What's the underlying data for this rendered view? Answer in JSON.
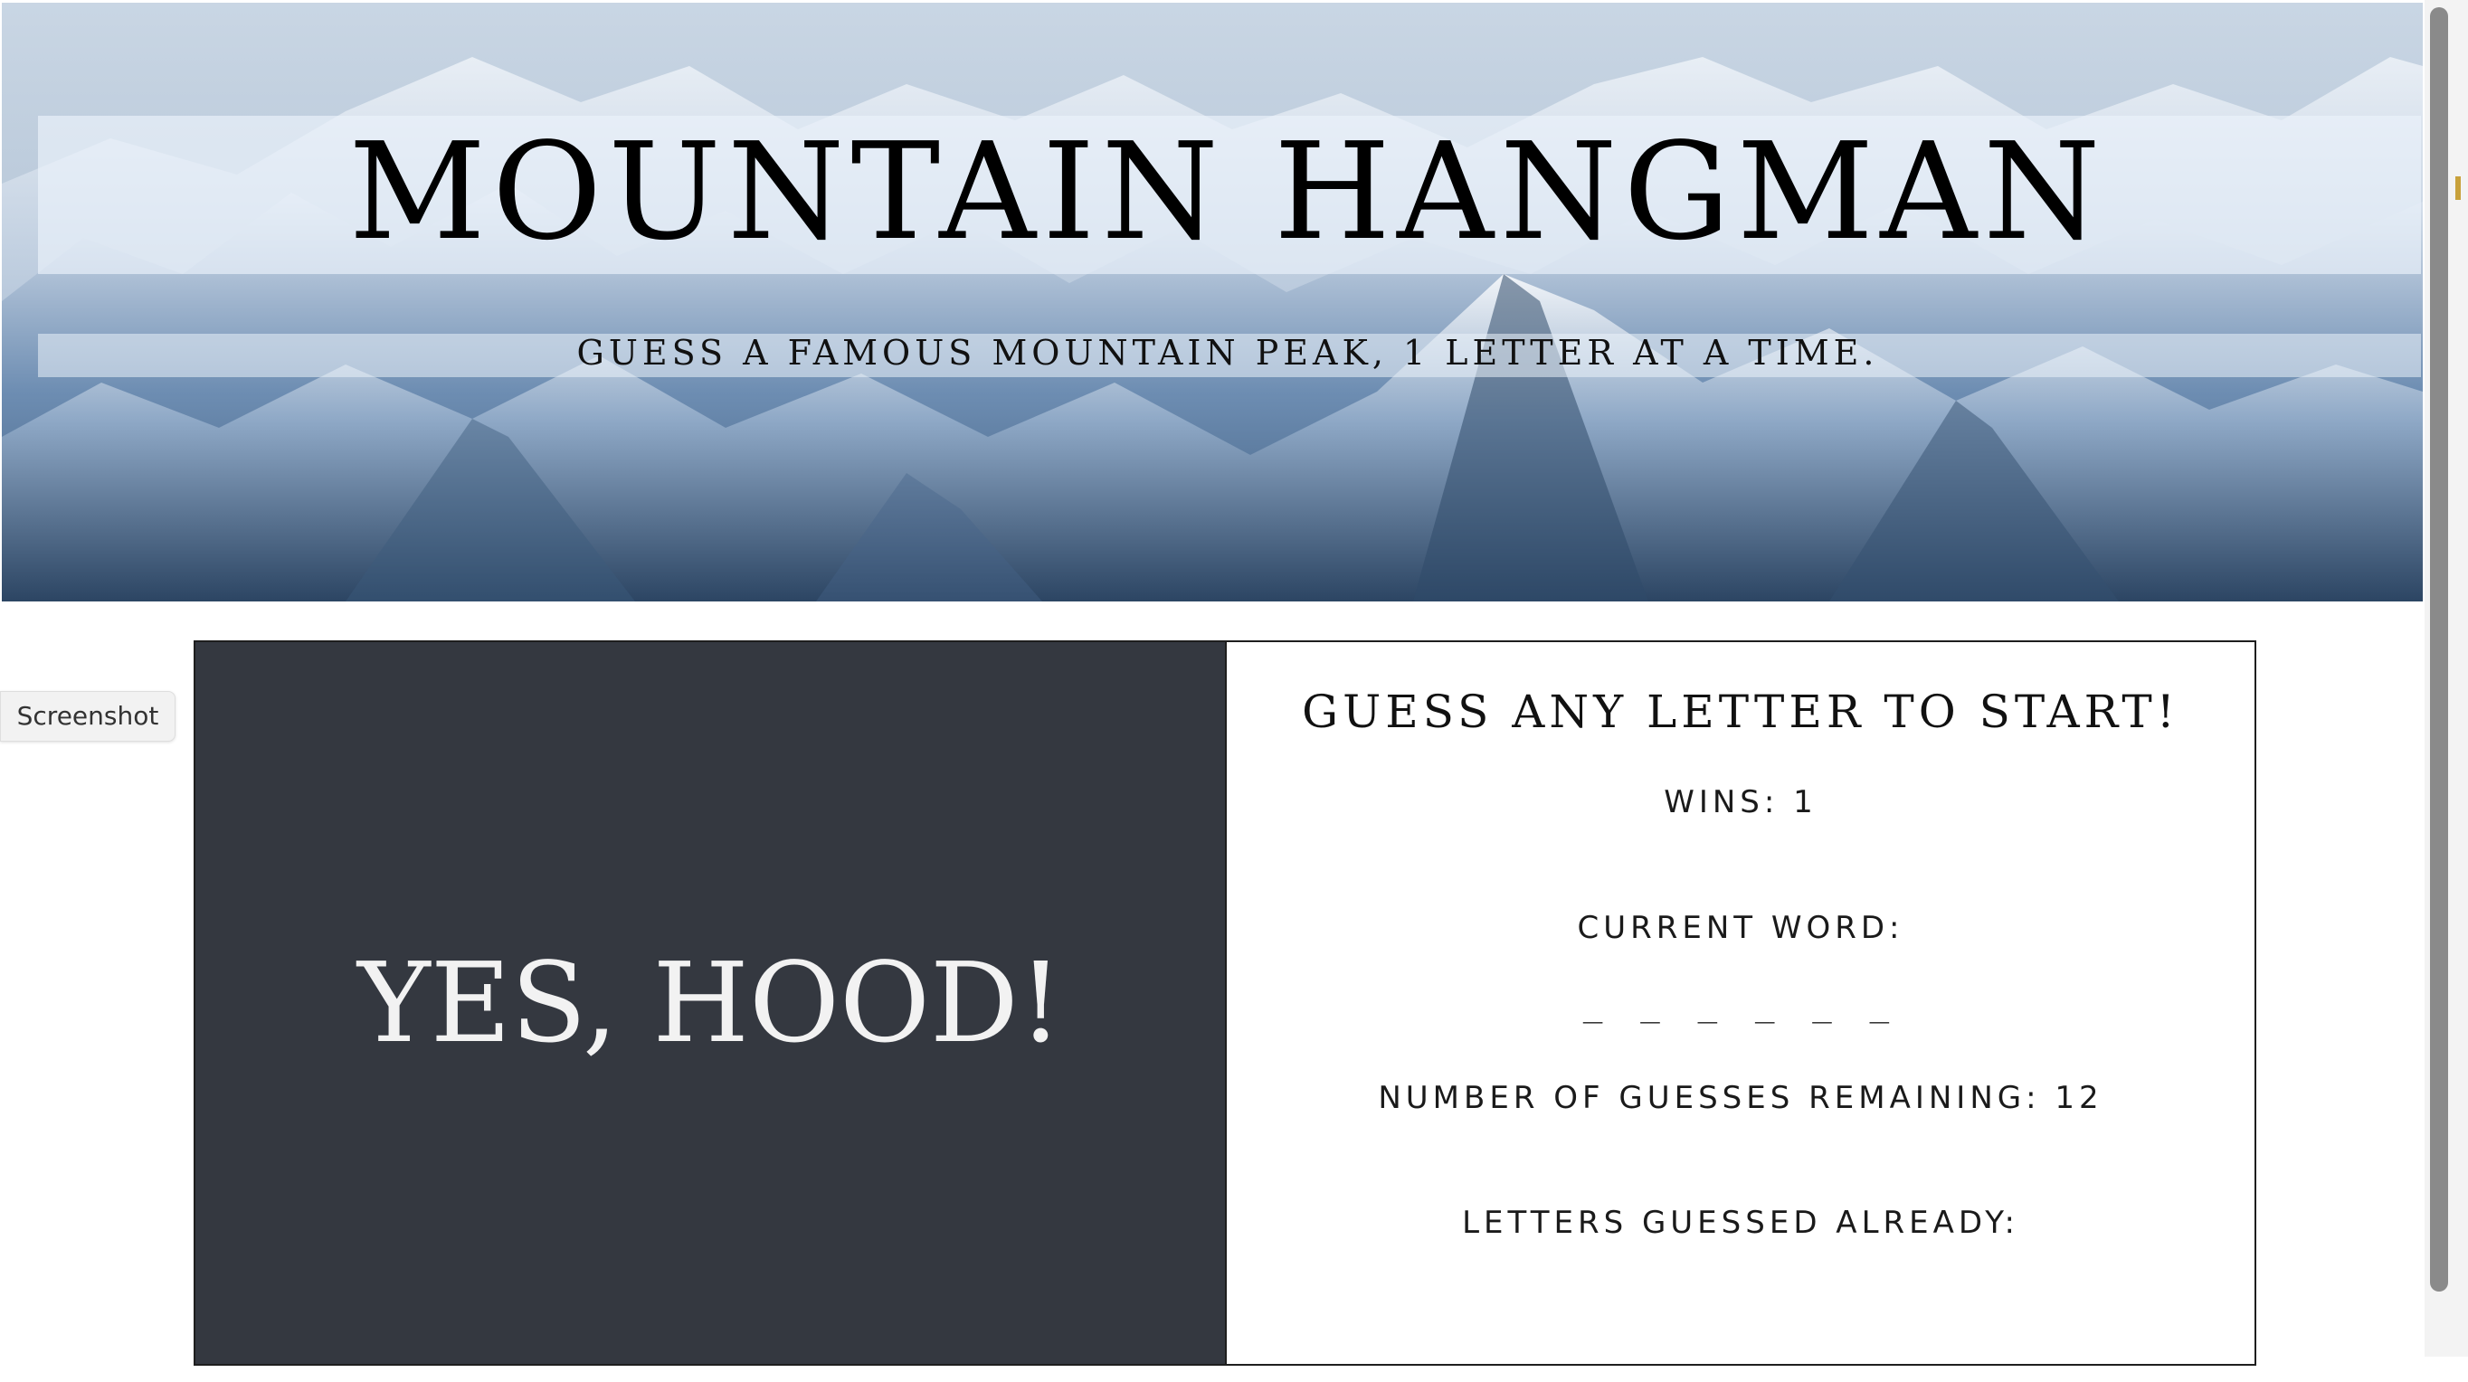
{
  "header": {
    "title": "MOUNTAIN HANGMAN",
    "subtitle": "GUESS A FAMOUS MOUNTAIN PEAK, 1 LETTER AT A TIME."
  },
  "screenshot_tab": {
    "label": "Screenshot"
  },
  "game": {
    "message": "YES, HOOD!",
    "prompt": "GUESS ANY LETTER TO START!",
    "wins_label": "WINS:",
    "wins_value": "1",
    "current_word_label": "CURRENT WORD:",
    "current_word_display": "_ _ _ _ _ _",
    "guesses_remaining_label": "NUMBER OF GUESSES REMAINING:",
    "guesses_remaining_value": "12",
    "letters_guessed_label": "LETTERS GUESSED ALREADY:",
    "letters_guessed_value": ""
  },
  "colors": {
    "message_panel_bg": "#343840",
    "message_text": "#f2f2f2",
    "frame_border": "#1e1e1e",
    "page_bg": "#ffffff"
  },
  "icons": {
    "hero_image": "snowy-mountains-image"
  }
}
